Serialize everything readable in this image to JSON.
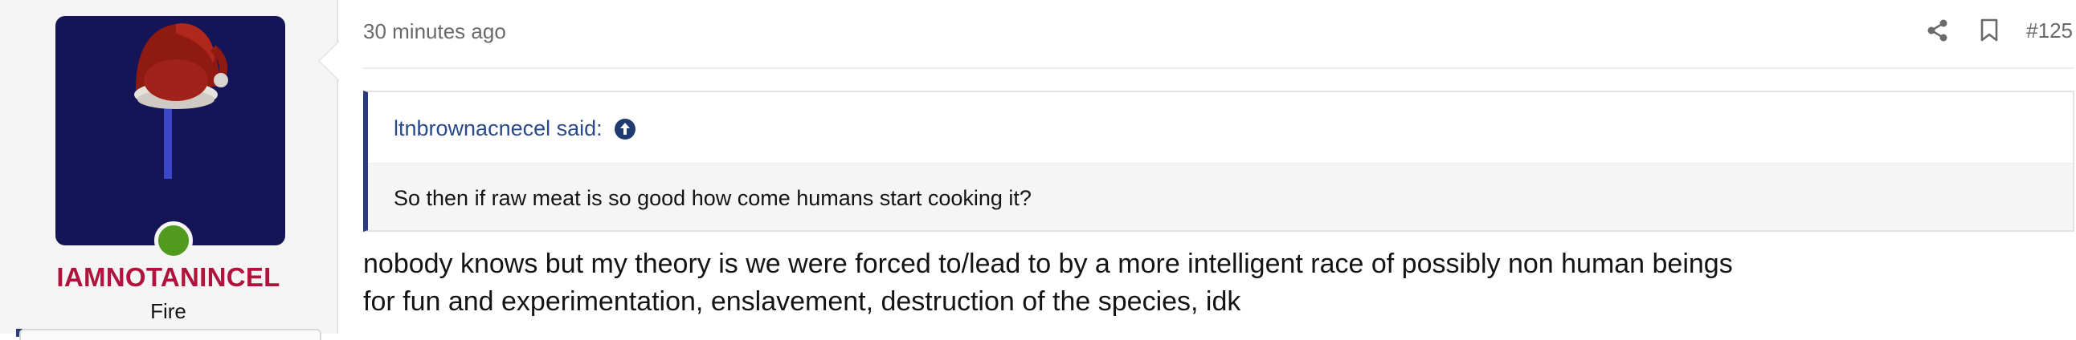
{
  "user": {
    "name": "IAMNOTANINCEL",
    "title": "Fire",
    "status_color": "#4f9a1f",
    "name_color": "#b0143c",
    "avatar_icon": "santa-hat-lollipop-avatar"
  },
  "post": {
    "time": "30 minutes ago",
    "number": "#125",
    "actions": [
      "share-icon",
      "bookmark-icon"
    ]
  },
  "quote": {
    "author_said": "ltnbrownacnecel said:",
    "text": "So then if raw meat is so good how come humans start cooking it?",
    "accent_color": "#2a3c7c"
  },
  "message": {
    "line1": "nobody knows but my theory is we were forced to/lead to by a more intelligent race of possibly non human beings",
    "line2": "for fun and experimentation, enslavement, destruction of the species, idk"
  }
}
